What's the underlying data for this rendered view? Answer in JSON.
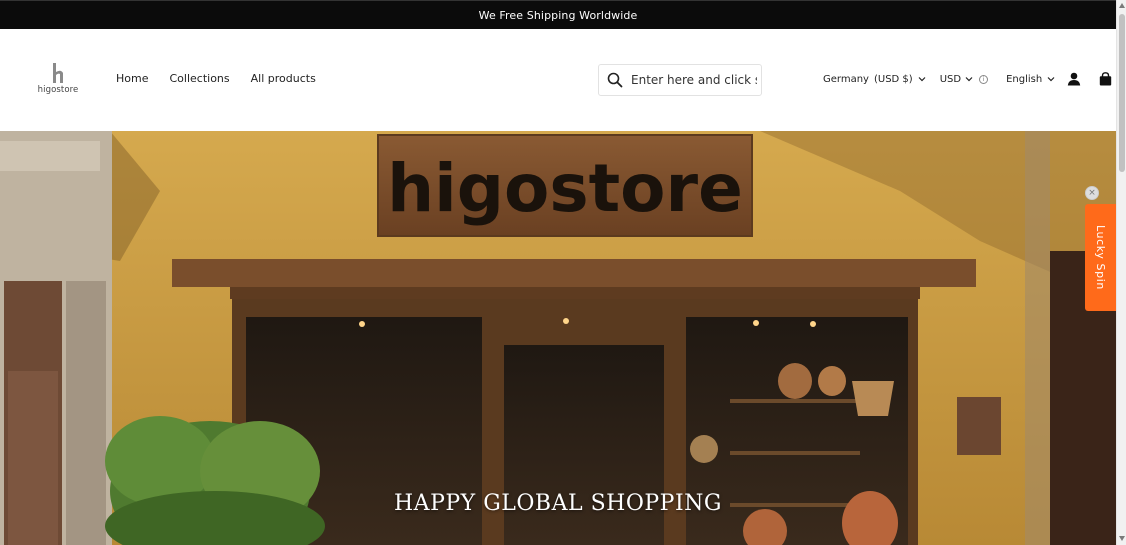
{
  "announcement": "We Free Shipping Worldwide",
  "logo": {
    "text": "higostore"
  },
  "nav": {
    "items": [
      {
        "label": "Home"
      },
      {
        "label": "Collections"
      },
      {
        "label": "All products"
      }
    ]
  },
  "search": {
    "placeholder": "Enter here and click search",
    "icon": "search-icon"
  },
  "locale": {
    "country": "Germany",
    "currency_note": "(USD $)"
  },
  "currency": {
    "selected": "USD",
    "info_icon": "info-icon"
  },
  "language": {
    "selected": "English"
  },
  "icons": {
    "account": "user-icon",
    "cart": "bag-icon"
  },
  "hero": {
    "caption": "HAPPY GLOBAL SHOPPING",
    "sign_text": "higostore"
  },
  "lucky_spin": {
    "label": "Lucky Spin",
    "close": "×"
  },
  "colors": {
    "accent": "#ff6a1a",
    "topbar": "#0b0b0b",
    "wall": "#c69a45"
  }
}
